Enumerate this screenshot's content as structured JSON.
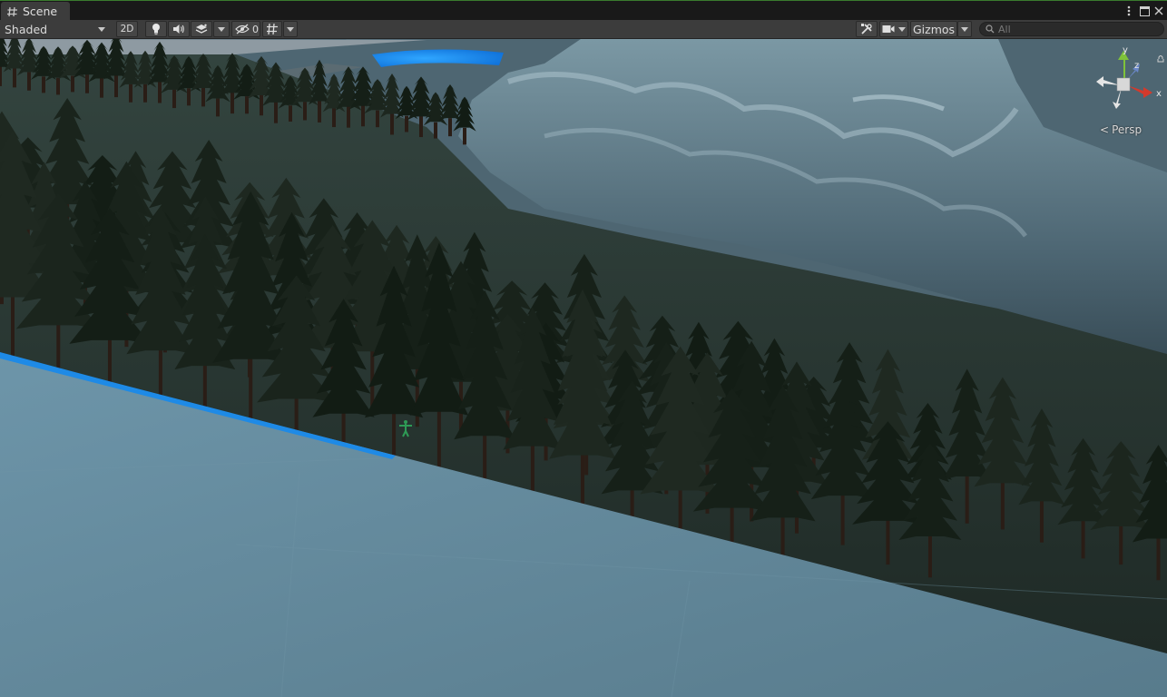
{
  "tab": {
    "label": "Scene",
    "icon": "scene-hash-icon"
  },
  "toolbar": {
    "shading_mode": "Shaded",
    "mode_2d": "2D",
    "hidden_count": "0",
    "gizmos_label": "Gizmos",
    "search_placeholder": "All"
  },
  "gizmo": {
    "y": "y",
    "z": "z",
    "x": "x",
    "projection": "Persp"
  },
  "colors": {
    "accent_green": "#3a7a2e",
    "water": "#1e90ff",
    "ground_plane": "#5a7f95",
    "terrain": "#2a3a36"
  }
}
